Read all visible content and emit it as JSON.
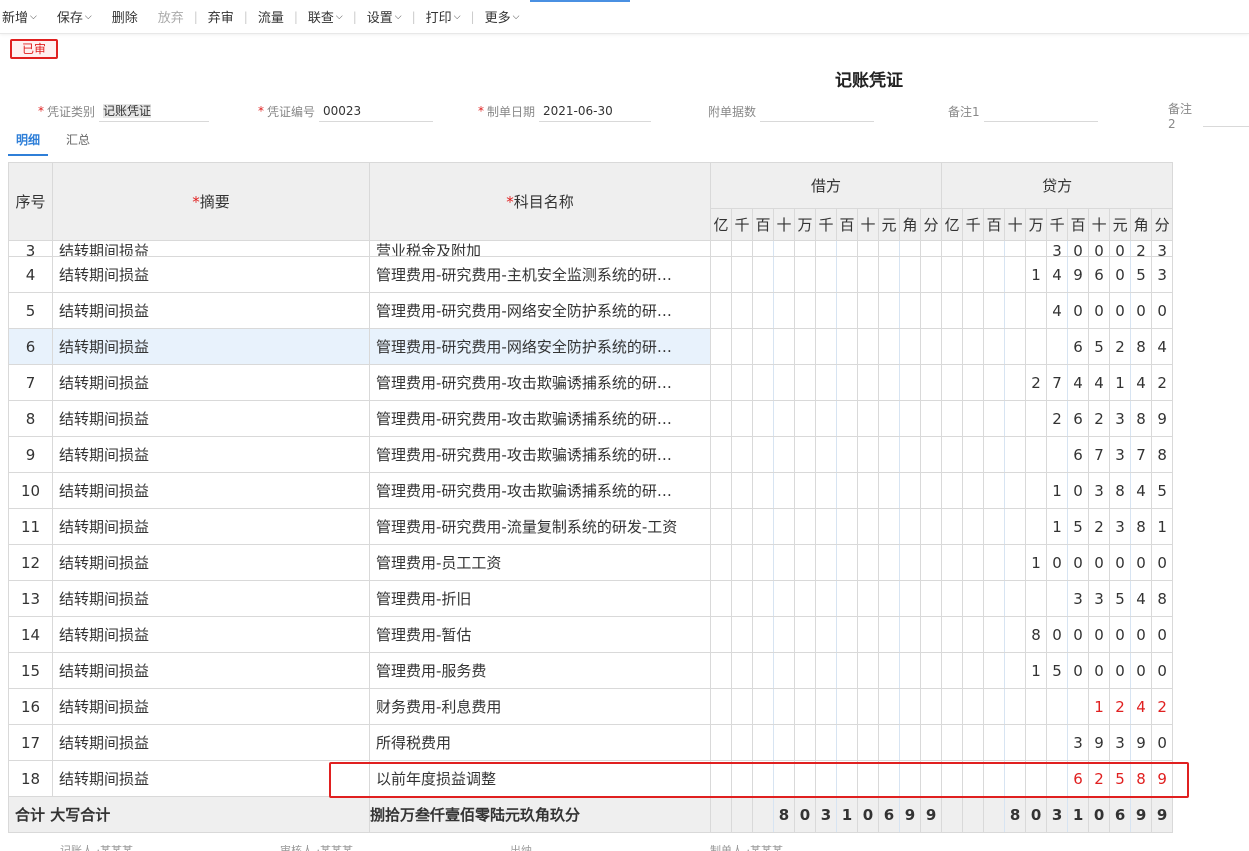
{
  "toolbar": [
    {
      "label": "新增",
      "dd": true
    },
    {
      "label": "保存",
      "dd": true
    },
    {
      "label": "删除",
      "dd": false
    },
    {
      "label": "放弃",
      "dd": false,
      "disabled": true
    },
    {
      "sep": true
    },
    {
      "label": "弃审",
      "dd": false
    },
    {
      "sep": true
    },
    {
      "label": "流量",
      "dd": false
    },
    {
      "sep": true
    },
    {
      "label": "联查",
      "dd": true
    },
    {
      "sep": true
    },
    {
      "label": "设置",
      "dd": true
    },
    {
      "sep": true
    },
    {
      "label": "打印",
      "dd": true
    },
    {
      "sep": true
    },
    {
      "label": "更多",
      "dd": true
    }
  ],
  "status_stamp": "已审",
  "title": "记账凭证",
  "fields": {
    "type_label": "凭证类别",
    "type_value": "记账凭证",
    "no_label": "凭证编号",
    "no_value": "00023",
    "date_label": "制单日期",
    "date_value": "2021-06-30",
    "attach_label": "附单据数",
    "note1_label": "备注1",
    "note2_label": "备注2"
  },
  "tabs": {
    "detail": "明细",
    "summary": "汇总"
  },
  "grid": {
    "col_no": "序号",
    "col_summary": "摘要",
    "col_account": "科目名称",
    "col_debit": "借方",
    "col_credit": "贷方",
    "digits": [
      "亿",
      "千",
      "百",
      "十",
      "万",
      "千",
      "百",
      "十",
      "元",
      "角",
      "分"
    ],
    "partial_row": {
      "no": "3",
      "summary": "结转期间损益",
      "account": "营业税金及附加",
      "credit": [
        "",
        "",
        "",
        "",
        "",
        "3",
        "0",
        "0",
        "0",
        "2",
        "3"
      ]
    },
    "rows": [
      {
        "no": "4",
        "summary": "结转期间损益",
        "account": "管理费用-研究费用-主机安全监测系统的研…",
        "credit": [
          "",
          "",
          "",
          "",
          "1",
          "4",
          "9",
          "6",
          "0",
          "5",
          "3"
        ],
        "red": false
      },
      {
        "no": "5",
        "summary": "结转期间损益",
        "account": "管理费用-研究费用-网络安全防护系统的研…",
        "credit": [
          "",
          "",
          "",
          "",
          "",
          "4",
          "0",
          "0",
          "0",
          "0",
          "0"
        ],
        "red": false
      },
      {
        "no": "6",
        "summary": "结转期间损益",
        "account": "管理费用-研究费用-网络安全防护系统的研…",
        "credit": [
          "",
          "",
          "",
          "",
          "",
          "",
          "6",
          "5",
          "2",
          "8",
          "4"
        ],
        "red": false,
        "selected": true
      },
      {
        "no": "7",
        "summary": "结转期间损益",
        "account": "管理费用-研究费用-攻击欺骗诱捕系统的研…",
        "credit": [
          "",
          "",
          "",
          "",
          "2",
          "7",
          "4",
          "4",
          "1",
          "4",
          "2"
        ],
        "red": false
      },
      {
        "no": "8",
        "summary": "结转期间损益",
        "account": "管理费用-研究费用-攻击欺骗诱捕系统的研…",
        "credit": [
          "",
          "",
          "",
          "",
          "",
          "2",
          "6",
          "2",
          "3",
          "8",
          "9"
        ],
        "red": false
      },
      {
        "no": "9",
        "summary": "结转期间损益",
        "account": "管理费用-研究费用-攻击欺骗诱捕系统的研…",
        "credit": [
          "",
          "",
          "",
          "",
          "",
          "",
          "6",
          "7",
          "3",
          "7",
          "8"
        ],
        "red": false
      },
      {
        "no": "10",
        "summary": "结转期间损益",
        "account": "管理费用-研究费用-攻击欺骗诱捕系统的研…",
        "credit": [
          "",
          "",
          "",
          "",
          "",
          "1",
          "0",
          "3",
          "8",
          "4",
          "5"
        ],
        "red": false
      },
      {
        "no": "11",
        "summary": "结转期间损益",
        "account": "管理费用-研究费用-流量复制系统的研发-工资",
        "credit": [
          "",
          "",
          "",
          "",
          "",
          "1",
          "5",
          "2",
          "3",
          "8",
          "1"
        ],
        "red": false
      },
      {
        "no": "12",
        "summary": "结转期间损益",
        "account": "管理费用-员工工资",
        "credit": [
          "",
          "",
          "",
          "",
          "1",
          "0",
          "0",
          "0",
          "0",
          "0",
          "0"
        ],
        "red": false
      },
      {
        "no": "13",
        "summary": "结转期间损益",
        "account": "管理费用-折旧",
        "credit": [
          "",
          "",
          "",
          "",
          "",
          "",
          "3",
          "3",
          "5",
          "4",
          "8"
        ],
        "red": false
      },
      {
        "no": "14",
        "summary": "结转期间损益",
        "account": "管理费用-暂估",
        "credit": [
          "",
          "",
          "",
          "",
          "8",
          "0",
          "0",
          "0",
          "0",
          "0",
          "0"
        ],
        "red": false
      },
      {
        "no": "15",
        "summary": "结转期间损益",
        "account": "管理费用-服务费",
        "credit": [
          "",
          "",
          "",
          "",
          "1",
          "5",
          "0",
          "0",
          "0",
          "0",
          "0"
        ],
        "red": false
      },
      {
        "no": "16",
        "summary": "结转期间损益",
        "account": "财务费用-利息费用",
        "credit": [
          "",
          "",
          "",
          "",
          "",
          "",
          "",
          "1",
          "2",
          "4",
          "2"
        ],
        "red": true
      },
      {
        "no": "17",
        "summary": "结转期间损益",
        "account": "所得税费用",
        "credit": [
          "",
          "",
          "",
          "",
          "",
          "",
          "3",
          "9",
          "3",
          "9",
          "0"
        ],
        "red": false
      },
      {
        "no": "18",
        "summary": "结转期间损益",
        "account": "以前年度损益调整",
        "credit": [
          "",
          "",
          "",
          "",
          "",
          "",
          "6",
          "2",
          "5",
          "8",
          "9"
        ],
        "red": true
      }
    ],
    "footer": {
      "total_label": "合计 大写合计",
      "amount_words": "捌拾万叁仟壹佰零陆元玖角玖分",
      "debit": [
        "",
        "",
        "",
        "8",
        "0",
        "3",
        "1",
        "0",
        "6",
        "9",
        "9"
      ],
      "credit": [
        "",
        "",
        "",
        "8",
        "0",
        "3",
        "1",
        "0",
        "6",
        "9",
        "9"
      ]
    }
  },
  "bottom": [
    "记账人 ·某某某",
    "审核人 ·某某某",
    "出纳",
    "制单人 ·某某某"
  ]
}
